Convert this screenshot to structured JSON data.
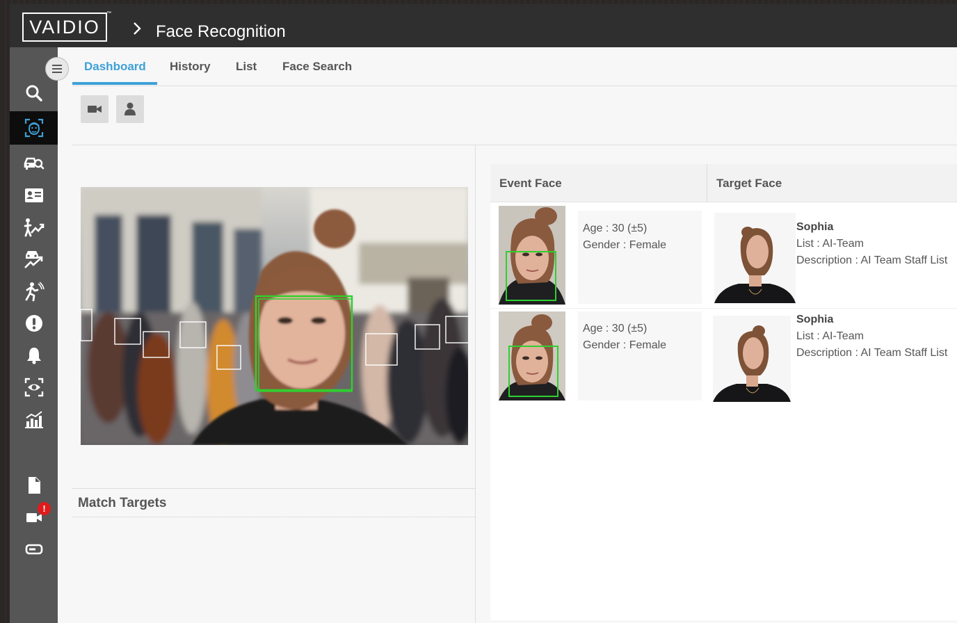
{
  "header": {
    "logo_text": "VAIDIO",
    "logo_tm": "™",
    "title": "Face Recognition"
  },
  "sidebar": {
    "items": [
      {
        "icon": "search-icon"
      },
      {
        "icon": "face-recognition-icon",
        "active": true
      },
      {
        "icon": "vehicle-search-icon"
      },
      {
        "icon": "id-card-icon"
      },
      {
        "icon": "person-trend-icon"
      },
      {
        "icon": "vehicle-trend-icon"
      },
      {
        "icon": "running-person-icon"
      },
      {
        "icon": "alert-icon"
      },
      {
        "icon": "bell-icon"
      },
      {
        "icon": "eye-scan-icon"
      },
      {
        "icon": "analytics-chart-icon"
      },
      {
        "icon": "document-icon"
      },
      {
        "icon": "camera-icon",
        "badge": "!"
      },
      {
        "icon": "device-icon"
      }
    ]
  },
  "tabs": [
    {
      "label": "Dashboard",
      "active": true
    },
    {
      "label": "History"
    },
    {
      "label": "List"
    },
    {
      "label": "Face Search"
    }
  ],
  "toolbar": {
    "buttons": [
      "camera-icon",
      "person-icon"
    ]
  },
  "match_targets": {
    "title": "Match Targets"
  },
  "results": {
    "col_event": "Event Face",
    "col_target": "Target Face",
    "rows": [
      {
        "age": "Age : 30 (±5)",
        "gender": "Gender : Female",
        "name": "Sophia",
        "list": "List : AI-Team",
        "description": "Description : AI Team Staff List"
      },
      {
        "age": "Age : 30 (±5)",
        "gender": "Gender : Female",
        "name": "Sophia",
        "list": "List : AI-Team",
        "description": "Description : AI Team Staff List"
      }
    ]
  },
  "colors": {
    "accent": "#3ea0d8",
    "header_bg": "#2f2f2f",
    "sidebar_bg": "#565656",
    "detect_box": "#2ed12e",
    "badge": "#e01b1b"
  }
}
